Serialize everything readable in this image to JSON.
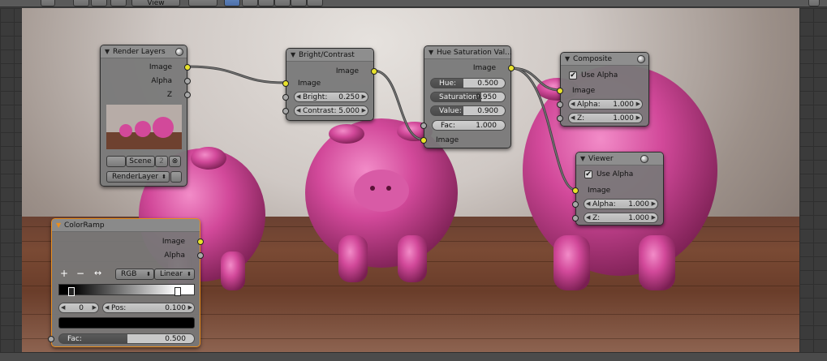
{
  "header": {
    "view_menu": "View"
  },
  "colors": {
    "socket_image": "#e8e22c",
    "socket_value": "#a8a8a8",
    "node_body": "#787878",
    "node_header": "#8e8e8e",
    "selected_outline": "#e98e1f",
    "pig": "#d2499a",
    "link": "#4a4a4a"
  },
  "nodes": {
    "render_layers": {
      "title": "Render Layers",
      "outputs": [
        "Image",
        "Alpha",
        "Z"
      ],
      "scene_label": "Scene",
      "scene_users": "2",
      "layer_label": "RenderLayer"
    },
    "bright_contrast": {
      "title": "Bright/Contrast",
      "output": "Image",
      "input": "Image",
      "bright_label": "Bright:",
      "bright_value": "0.250",
      "contrast_label": "Contrast:",
      "contrast_value": "5.000"
    },
    "hue_sat": {
      "title": "Hue Saturation Val...",
      "output": "Image",
      "hue_label": "Hue:",
      "hue_value": "0.500",
      "sat_label": "Saturation:",
      "sat_value": "0.950",
      "val_label": "Value:",
      "val_value": "0.900",
      "fac_label": "Fac:",
      "fac_value": "1.000",
      "input": "Image"
    },
    "composite": {
      "title": "Composite",
      "use_alpha": "Use Alpha",
      "input": "Image",
      "alpha_label": "Alpha:",
      "alpha_value": "1.000",
      "z_label": "Z:",
      "z_value": "1.000"
    },
    "viewer": {
      "title": "Viewer",
      "use_alpha": "Use Alpha",
      "input": "Image",
      "alpha_label": "Alpha:",
      "alpha_value": "1.000",
      "z_label": "Z:",
      "z_value": "1.000"
    },
    "color_ramp": {
      "title": "ColorRamp",
      "outputs": [
        "Image",
        "Alpha"
      ],
      "add": "+",
      "remove": "−",
      "flip": "↔",
      "color_mode": "RGB",
      "interpolation": "Linear",
      "index_value": "0",
      "pos_label": "Pos:",
      "pos_value": "0.100",
      "fac_label": "Fac:",
      "fac_value": "0.500"
    }
  }
}
